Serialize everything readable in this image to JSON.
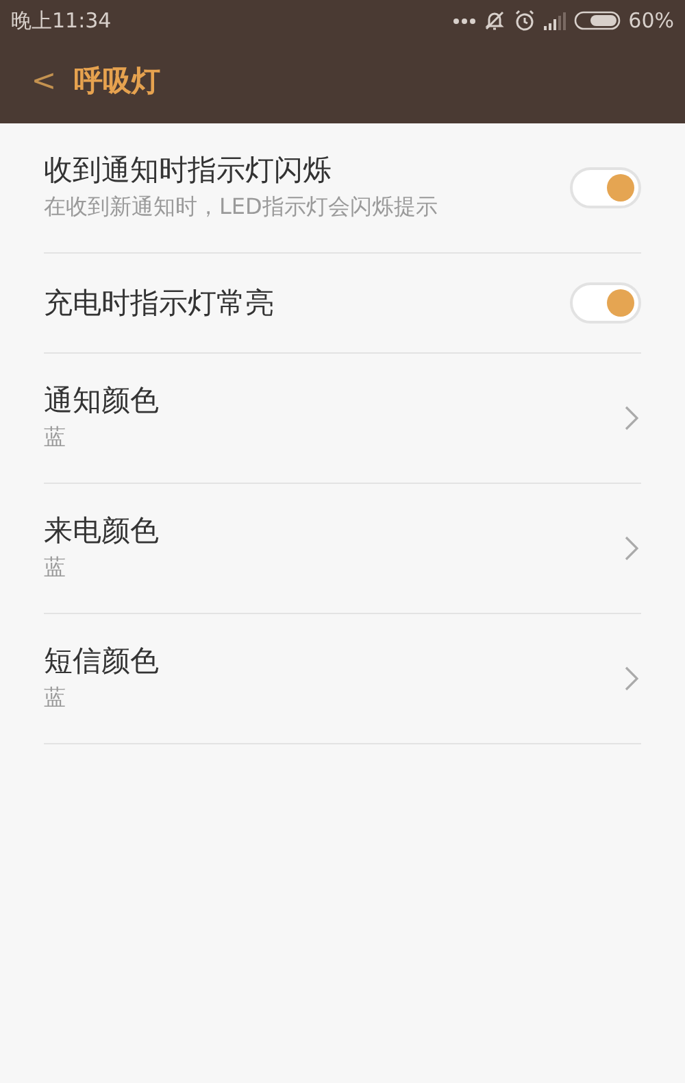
{
  "status_bar": {
    "time": "晚上11:34",
    "battery_percent": "60%"
  },
  "header": {
    "back": "<",
    "title": "呼吸灯"
  },
  "items": [
    {
      "kind": "toggle",
      "title": "收到通知时指示灯闪烁",
      "subtitle": "在收到新通知时，LED指示灯会闪烁提示",
      "on": true
    },
    {
      "kind": "toggle",
      "title": "充电时指示灯常亮",
      "on": true
    },
    {
      "kind": "link",
      "title": "通知颜色",
      "subtitle": "蓝"
    },
    {
      "kind": "link",
      "title": "来电颜色",
      "subtitle": "蓝"
    },
    {
      "kind": "link",
      "title": "短信颜色",
      "subtitle": "蓝"
    }
  ]
}
